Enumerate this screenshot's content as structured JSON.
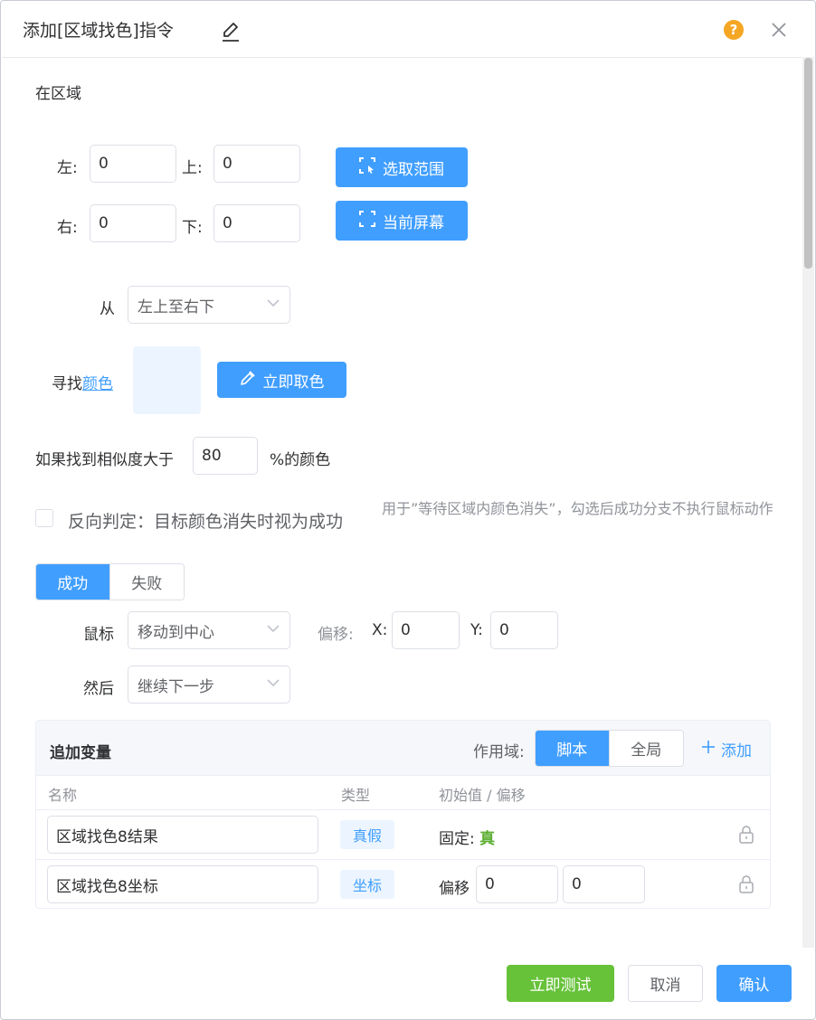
{
  "dialog": {
    "title": "添加[区域找色]指令",
    "help_icon": "question-circle-icon",
    "close_icon": "close-icon",
    "edit_icon": "pencil-icon"
  },
  "region": {
    "section_label": "在区域",
    "left_label": "左:",
    "left_value": "0",
    "top_label": "上:",
    "top_value": "0",
    "right_label": "右:",
    "right_value": "0",
    "bottom_label": "下:",
    "bottom_value": "0",
    "select_range_button": "选取范围",
    "current_screen_button": "当前屏幕"
  },
  "direction": {
    "label": "从",
    "value": "左上至右下"
  },
  "find_color": {
    "label_prefix": "寻找",
    "label_link": "颜色",
    "swatch_color": "#ecf5ff",
    "pick_button": "立即取色"
  },
  "similarity": {
    "prefix": "如果找到相似度大于",
    "value": "80",
    "suffix": "%的颜色"
  },
  "reverse": {
    "checkbox_label": "反向判定：目标颜色消失时视为成功",
    "hint": "用于”等待区域内颜色消失”，勾选后成功分支不执行鼠标动作"
  },
  "branch_tabs": {
    "success": "成功",
    "failure": "失败"
  },
  "mouse": {
    "label": "鼠标",
    "value": "移动到中心",
    "offset_label": "偏移:",
    "x_label": "X:",
    "x_value": "0",
    "y_label": "Y:",
    "y_value": "0"
  },
  "then": {
    "label": "然后",
    "value": "继续下一步"
  },
  "variables": {
    "title": "追加变量",
    "scope_label": "作用域:",
    "scope_script": "脚本",
    "scope_global": "全局",
    "add_button": "添加",
    "col_name": "名称",
    "col_type": "类型",
    "col_initial": "初始值 / 偏移",
    "rows": [
      {
        "name": "区域找色8结果",
        "type": "真假",
        "init_label": "固定:",
        "init_value": "真"
      },
      {
        "name": "区域找色8坐标",
        "type": "坐标",
        "init_label": "偏移",
        "x": "0",
        "y": "0"
      }
    ]
  },
  "footer": {
    "test_button": "立即测试",
    "cancel_button": "取消",
    "confirm_button": "确认"
  },
  "colors": {
    "primary": "#409eff",
    "success": "#67c23a",
    "true_text": "#5daf34",
    "help": "#f5a623"
  }
}
